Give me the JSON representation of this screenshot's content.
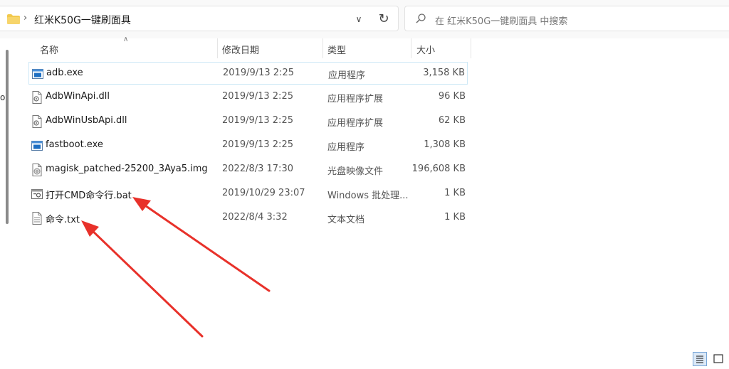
{
  "address": {
    "path": "红米K50G一键刷面具"
  },
  "search": {
    "placeholder": "在 红米K50G一键刷面具 中搜索"
  },
  "left_glyph": "o",
  "columns": {
    "name": "名称",
    "date": "修改日期",
    "type": "类型",
    "size": "大小"
  },
  "files": [
    {
      "name": "adb.exe",
      "date": "2019/9/13 2:25",
      "type": "应用程序",
      "size": "3,158 KB",
      "icon": "exe-icon",
      "selected": true
    },
    {
      "name": "AdbWinApi.dll",
      "date": "2019/9/13 2:25",
      "type": "应用程序扩展",
      "size": "96 KB",
      "icon": "dll-icon"
    },
    {
      "name": "AdbWinUsbApi.dll",
      "date": "2019/9/13 2:25",
      "type": "应用程序扩展",
      "size": "62 KB",
      "icon": "dll-icon"
    },
    {
      "name": "fastboot.exe",
      "date": "2019/9/13 2:25",
      "type": "应用程序",
      "size": "1,308 KB",
      "icon": "exe-icon"
    },
    {
      "name": "magisk_patched-25200_3Aya5.img",
      "date": "2022/8/3 17:30",
      "type": "光盘映像文件",
      "size": "196,608 KB",
      "icon": "disc-image-icon"
    },
    {
      "name": "打开CMD命令行.bat",
      "date": "2019/10/29 23:07",
      "type": "Windows 批处理...",
      "size": "1 KB",
      "icon": "batch-file-icon"
    },
    {
      "name": "命令.txt",
      "date": "2022/8/4 3:32",
      "type": "文本文档",
      "size": "1 KB",
      "icon": "text-file-icon"
    }
  ],
  "colors": {
    "annotation_arrow": "#e8312a",
    "selection_border": "#cde8f6",
    "folder": "#f2c94c"
  }
}
